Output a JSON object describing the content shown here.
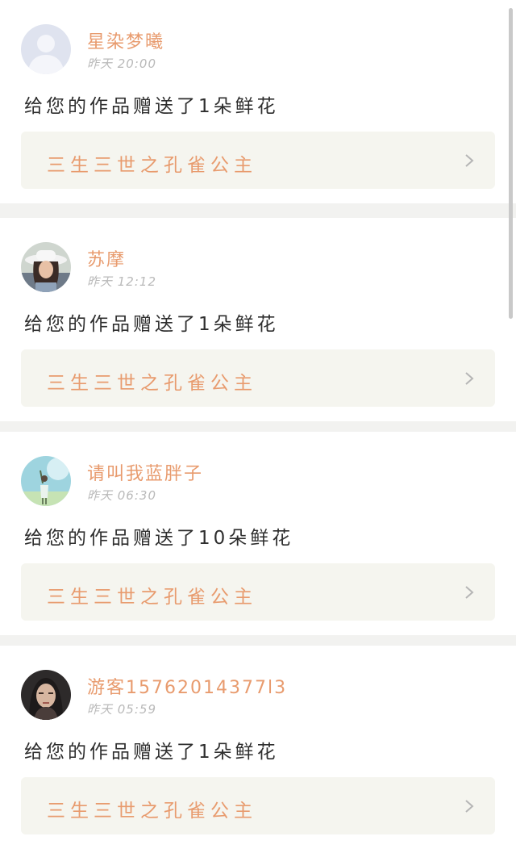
{
  "notifications": [
    {
      "username": "星染梦曦",
      "time": "昨天 20:00",
      "message": "给您的作品赠送了1朵鲜花",
      "work_title": "三生三世之孔雀公主",
      "avatar": "default-avatar-icon"
    },
    {
      "username": "苏摩",
      "time": "昨天 12:12",
      "message": "给您的作品赠送了1朵鲜花",
      "work_title": "三生三世之孔雀公主",
      "avatar": "user-photo-hat"
    },
    {
      "username": "请叫我蓝胖子",
      "time": "昨天 06:30",
      "message": "给您的作品赠送了10朵鲜花",
      "work_title": "三生三世之孔雀公主",
      "avatar": "user-photo-sky"
    },
    {
      "username": "游客15762014377l3",
      "time": "昨天 05:59",
      "message": "给您的作品赠送了1朵鲜花",
      "work_title": "三生三世之孔雀公主",
      "avatar": "user-photo-portrait"
    }
  ],
  "colors": {
    "accent": "#e89b6e",
    "page_bg": "#f2f2f0",
    "card_bg": "#ffffff",
    "link_bg": "#f5f5ef",
    "text": "#2e2e2e",
    "muted": "#b9b9b9"
  }
}
